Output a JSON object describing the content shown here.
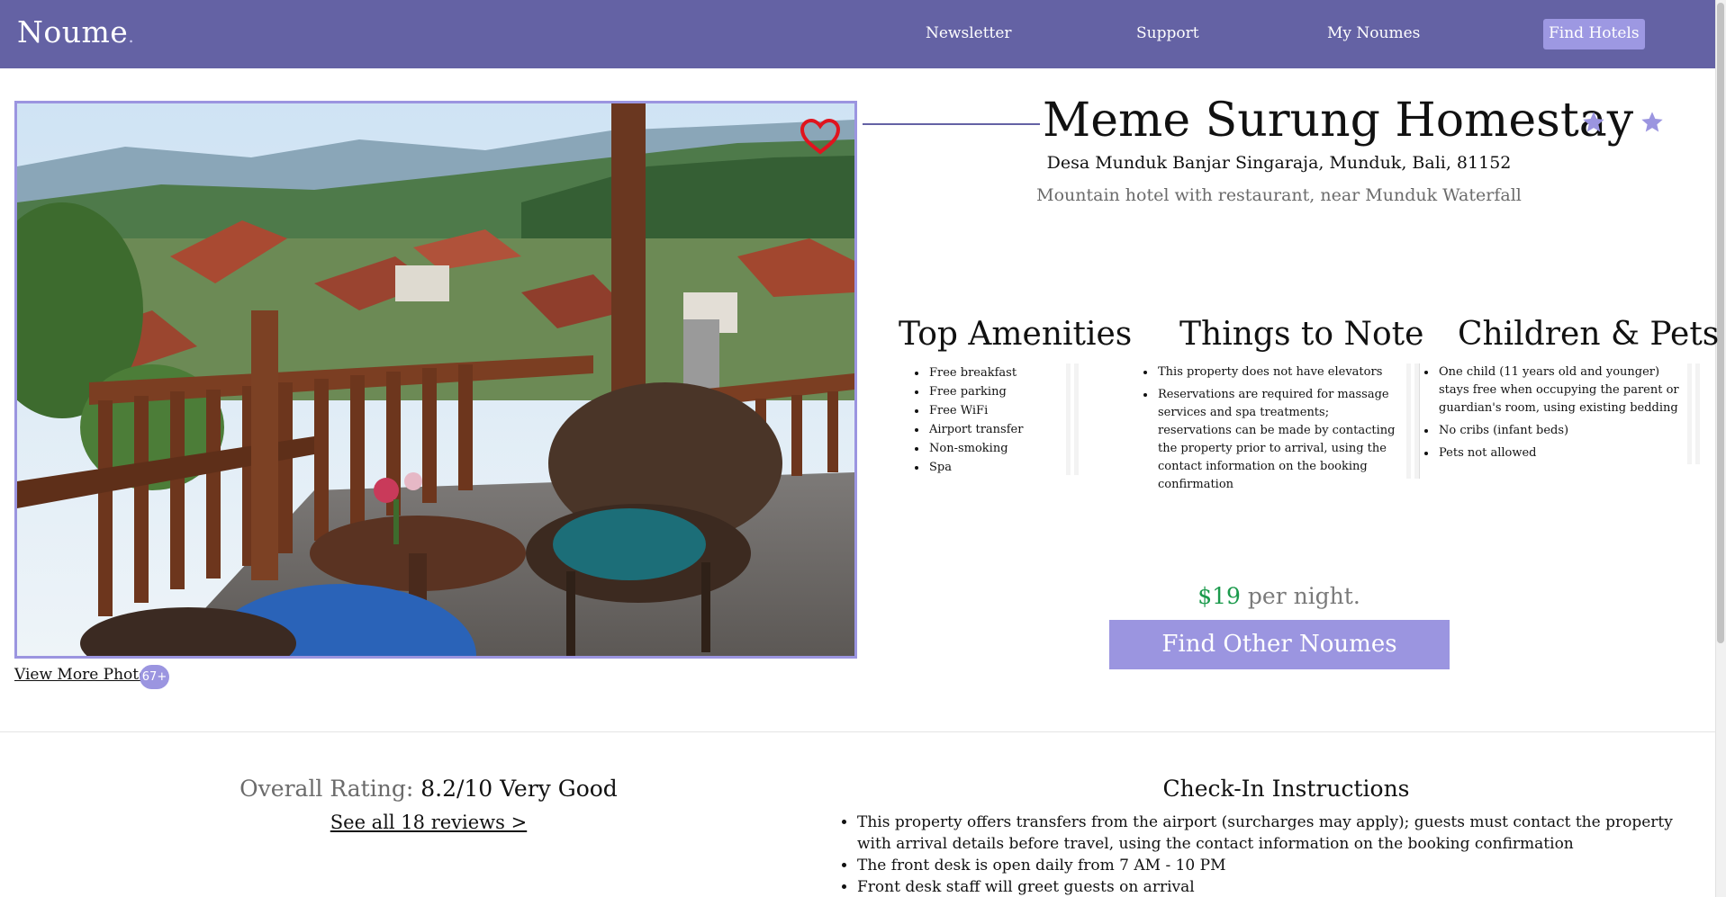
{
  "header": {
    "logo": "Noume",
    "logo_dot": ".",
    "nav": {
      "newsletter": "Newsletter",
      "support": "Support",
      "my_noumes": "My Noumes",
      "find_hotels": "Find Hotels"
    }
  },
  "gallery": {
    "view_more_label": "View More Photos",
    "photo_count": "67+",
    "favorite_icon": "heart-outline-icon",
    "favorite_color": "#e0141e"
  },
  "hotel": {
    "name": "Meme Surung Homestay",
    "star_icon": "star-icon",
    "star_color": "#9b95e0",
    "address": "Desa Munduk Banjar Singaraja, Munduk, Bali, 81152",
    "tagline": "Mountain hotel with restaurant, near Munduk Waterfall"
  },
  "amenities": {
    "title": "Top Amenities",
    "items": [
      "Free breakfast",
      "Free parking",
      "Free WiFi",
      "Airport transfer",
      "Non-smoking",
      "Spa"
    ]
  },
  "notes": {
    "title": "Things to Note",
    "items": [
      "This property does not have elevators",
      "Reservations are required for massage services and spa treatments; reservations can be made by contacting the property prior to arrival, using the contact information on the booking confirmation"
    ]
  },
  "children_pets": {
    "title": "Children & Pets",
    "items": [
      "One child (11 years old and younger) stays free when occupying the parent or guardian's room, using existing bedding",
      "No cribs (infant beds)",
      "Pets not allowed"
    ]
  },
  "pricing": {
    "amount": "$19",
    "suffix": "per night.",
    "amount_color": "#1b9a4c",
    "cta": "Find Other Noumes"
  },
  "rating": {
    "label": "Overall Rating:",
    "value": "8.2/10 Very Good",
    "reviews_link": "See all 18 reviews >"
  },
  "checkin": {
    "title": "Check-In Instructions",
    "items": [
      "This property offers transfers from the airport (surcharges may apply); guests must contact the property with arrival details before travel, using the contact information on the booking confirmation",
      "The front desk is open daily from 7 AM - 10 PM",
      "Front desk staff will greet guests on arrival"
    ]
  },
  "colors": {
    "brand": "#6462a4",
    "accent": "#9b95e0"
  }
}
